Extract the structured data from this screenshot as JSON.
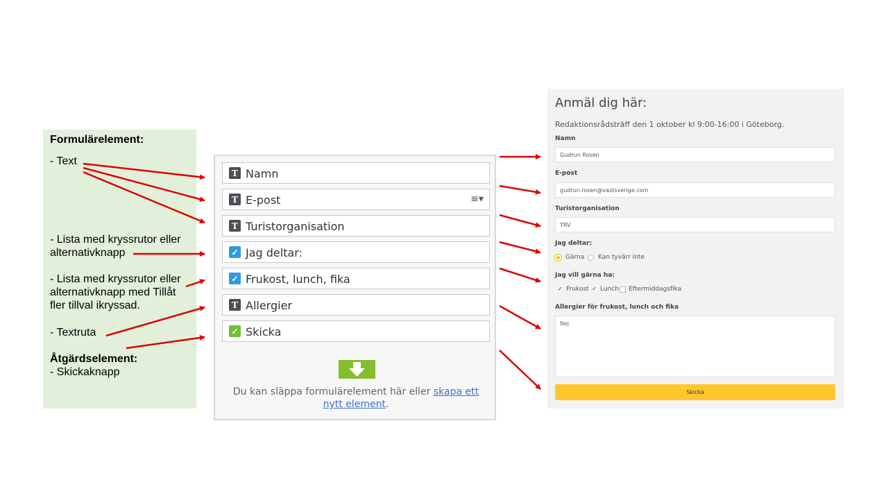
{
  "legend": {
    "heading": "Formulärelement:",
    "text": "- Text",
    "list_single_1": "- Lista med kryssrutor eller",
    "list_single_2": "alternativknapp",
    "list_multi_1": "- Lista med kryssrutor eller",
    "list_multi_2": "alternativknapp med Tillåt",
    "list_multi_3": "fler tillval ikryssad.",
    "textarea": "- Textruta",
    "action_heading": "Åtgärdselement:",
    "submit": "- Skickaknapp"
  },
  "builder": {
    "rows": [
      {
        "label": "Namn",
        "icon": "text-field-icon"
      },
      {
        "label": "E-post",
        "icon": "text-field-icon"
      },
      {
        "label": "Turistorganisation",
        "icon": "text-field-icon"
      },
      {
        "label": "Jag deltar:",
        "icon": "checkbox-list-icon"
      },
      {
        "label": "Frukost, lunch, fika",
        "icon": "checkbox-list-icon"
      },
      {
        "label": "Allergier",
        "icon": "textarea-icon"
      },
      {
        "label": "Skicka",
        "icon": "submit-icon"
      }
    ],
    "menu_icon": "≡▾",
    "drop_text": "Du kan släppa formulärelement här eller ",
    "drop_link": "skapa ett nytt element",
    "drop_end": "."
  },
  "form": {
    "title": "Anmäl dig här:",
    "subtitle": "Redaktionsrådsträff den 1 oktober kl 9:00-16:00 i Göteborg.",
    "name_label": "Namn",
    "name_value": "Gudrun Rosen",
    "email_label": "E-post",
    "email_value": "gudrun.rosen@vastsverige.com",
    "org_label": "Turistorganisation",
    "org_value": "TRV",
    "attend_label": "Jag deltar:",
    "attend_options": [
      "Gärna",
      "Kan tyvärr inte"
    ],
    "attend_selected": "Gärna",
    "meals_label": "Jag vill gärna ha:",
    "meal_options": [
      "Frukost",
      "Lunch",
      "Eftermiddagsfika"
    ],
    "meals_checked": [
      "Frukost",
      "Lunch"
    ],
    "allergy_label": "Allergier för frukost, lunch och fika",
    "allergy_value": "Nej",
    "submit_label": "Skicka",
    "accent_color": "#ffc72c"
  },
  "arrow_color": "#e00000"
}
